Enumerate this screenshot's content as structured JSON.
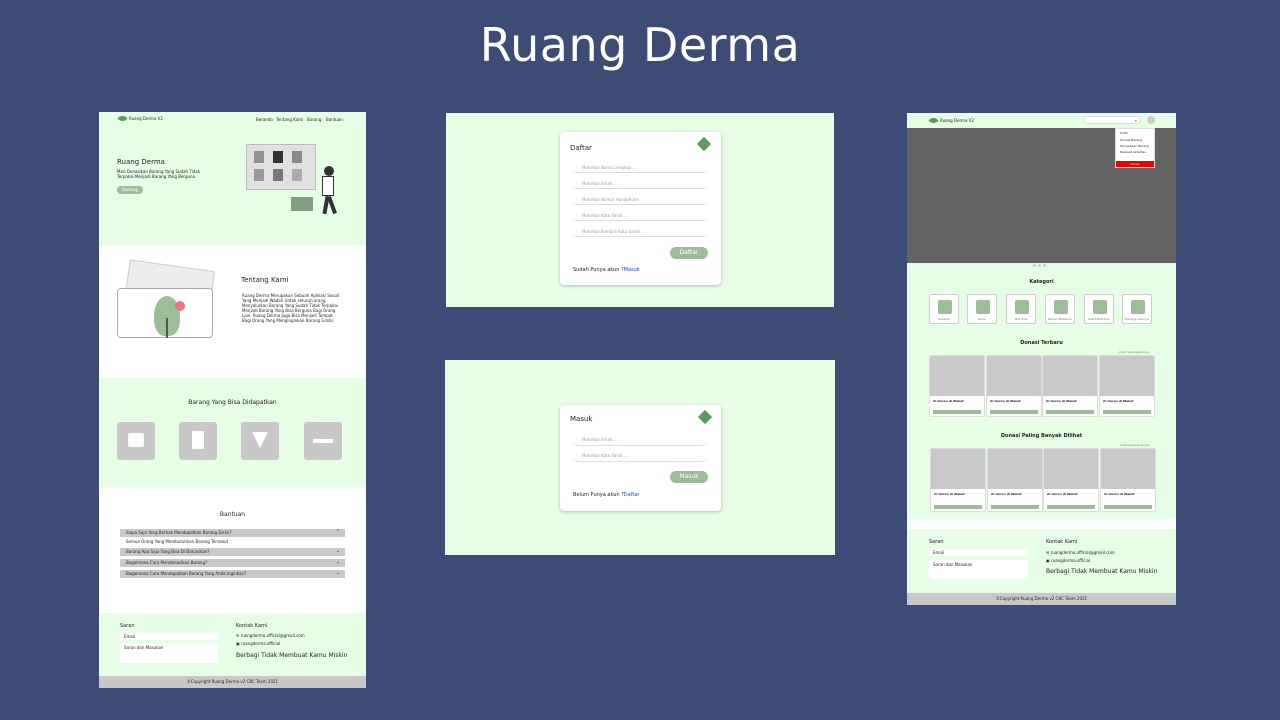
{
  "page_title": "Ruang Derma",
  "left": {
    "logo": "Ruang Derma V2",
    "nav": [
      "Beranda",
      "Tentang Kami",
      "Barang",
      "Bantuan"
    ],
    "hero_title": "Ruang Derma",
    "hero_text": "Mari Donasikan Barang Yang Sudah Tidak Terpakai Menjadi Barang Yang Berguna",
    "hero_button": "Bahang",
    "about_title": "Tentang Kami",
    "about_text": "Ruang Derma Merupakan Sebuah Aplikasi Sosial Yang Menjadi Wadah Untuk seluruh orang Menyalurkan Barang Yang Sudah Tidak Terpakai Menjadi Barang Yang Bisa Berguna Bagi Orang Lain. Ruang Derma Juga Bisa Menjadi Tempat Bagi Orang Yang Menginginkan Barang Gratis",
    "items_title": "Barang Yang Bisa Didapatkan",
    "help_title": "Bantuan",
    "faq": [
      {
        "q": "Siapa Saja Yang Berhak Mendapatkan Barang Disini?",
        "a": "Semua Orang Yang Membutuhkan Barang Tersebut"
      },
      {
        "q": "Barang Apa Saja Yang Bisa Di Donasikan?"
      },
      {
        "q": "Bagaimana Cara Mendonasikan Barang?"
      },
      {
        "q": "Bagaimana Cara Mendapatkan Barang Yang Anda Inginkan?"
      }
    ],
    "saran_title": "Saran",
    "email_placeholder": "Email",
    "saran_placeholder": "Saran dan Masukan",
    "contact_title": "Kontak Kami",
    "contact_email": "ruangderma.official@gmail.com",
    "contact_ig": "ruangderma.official",
    "tagline": "Berbagi Tidak Membuat Kamu Miskin",
    "copyright": "©Copyright Ruang Derma v2 CBC Team 2021"
  },
  "register": {
    "title": "Daftar",
    "fields": [
      "Masukan Nama Lengkap ...",
      "Masukan Email ...",
      "Masukan Nomor Handphone",
      "Masukan Kata Sandi ...",
      "Masukan Kembali Kata Sandi ..."
    ],
    "button": "Daftar",
    "footer_text": "Sudah Punya akun ?",
    "footer_link": "Masuk"
  },
  "login": {
    "title": "Masuk",
    "fields": [
      "Masukan Email ...",
      "Masukan Kata Sandi ..."
    ],
    "button": "Masuk",
    "footer_text": "Belum Punya akun ?",
    "footer_link": "Daftar"
  },
  "right": {
    "logo": "Ruang Derma V2",
    "menu": [
      "Profil",
      "Donasi Barang",
      "Permintaan Barang",
      "Riwayat Aktivitas",
      "Keluar"
    ],
    "kategori_title": "Kategori",
    "categories": [
      "Pakaian",
      "Buku",
      "Alat Tulis",
      "Bahan Makanan",
      "Alat Elektronik",
      "Barang Lainnya"
    ],
    "donasi_title": "Donasi Terbaru",
    "popular_title": "Donasi Paling Banyak Dilihat",
    "see_all": "Lihat Selengkapnya",
    "card_title": "Al Quran di Wakaf",
    "card_button": "Lihat Selengkapnya",
    "saran_title": "Saran",
    "email_placeholder": "Email",
    "saran_placeholder": "Saran dan Masukan",
    "contact_title": "Kontak Kami",
    "contact_email": "ruangderma.official@gmail.com",
    "contact_ig": "ruangderma.official",
    "tagline": "Berbagi Tidak Membuat Kamu Miskin",
    "copyright": "©Copyright Ruang Derma v2 CBC Team 2021"
  }
}
